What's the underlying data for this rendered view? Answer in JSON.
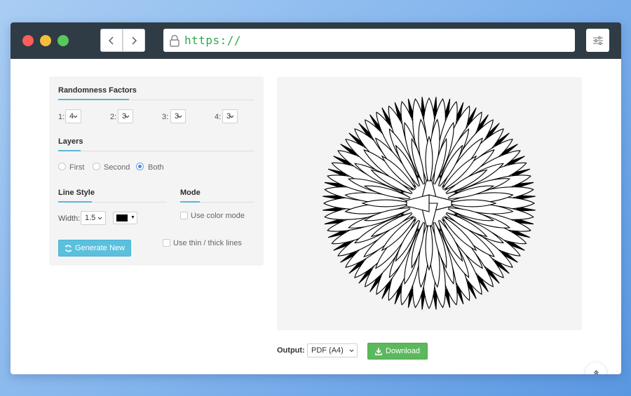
{
  "browser": {
    "url": "https://"
  },
  "randomness": {
    "title": "Randomness Factors",
    "factors": [
      {
        "label": "1:",
        "value": "4"
      },
      {
        "label": "2:",
        "value": "3"
      },
      {
        "label": "3:",
        "value": "3"
      },
      {
        "label": "4:",
        "value": "3"
      }
    ]
  },
  "layers": {
    "title": "Layers",
    "options": [
      "First",
      "Second",
      "Both"
    ],
    "selected": "Both"
  },
  "line_style": {
    "title": "Line Style",
    "width_label": "Width:",
    "width_value": "1.5",
    "color": "#000000"
  },
  "mode": {
    "title": "Mode",
    "color_mode_label": "Use color mode",
    "thin_thick_label": "Use thin / thick lines"
  },
  "generate_label": "Generate New",
  "output": {
    "label": "Output:",
    "value": "PDF (A4)",
    "download_label": "Download"
  },
  "colors": {
    "titlebar": "#2f3b45",
    "url_text": "#2ea84f",
    "accent_line": "#5bb6d9",
    "generate_button": "#5bc0de",
    "download_button": "#5cb85c"
  }
}
